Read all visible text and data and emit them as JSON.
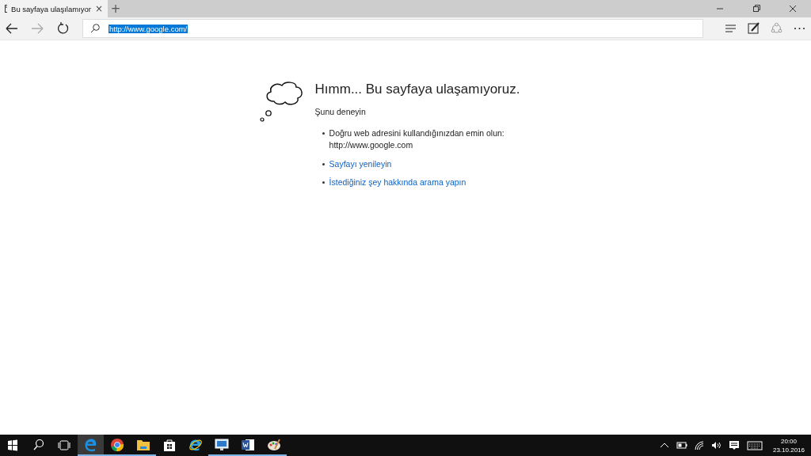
{
  "tabs": [
    {
      "title": "Bu sayfaya ulaşılamıyor",
      "close": "×",
      "selected": true
    }
  ],
  "new_tab": "+",
  "address_bar": {
    "value": "http://www.google.com/",
    "selected": true
  },
  "error_page": {
    "heading": "Hımm... Bu sayfaya ulaşamıyoruz.",
    "subheading": "Şunu deneyin",
    "items": [
      {
        "kind": "text",
        "lines": [
          "Doğru web adresini kullandığınızdan emin olun:",
          "http://www.google.com"
        ]
      },
      {
        "kind": "link",
        "lines": [
          "Sayfayı yenileyin"
        ]
      },
      {
        "kind": "link",
        "lines": [
          "İstediğiniz şey hakkında arama yapın"
        ]
      }
    ]
  },
  "taskbar": {
    "apps": [
      {
        "kind": "edge",
        "selected": true,
        "running": true
      },
      {
        "kind": "chrome",
        "selected": false,
        "running": true
      },
      {
        "kind": "explorer",
        "selected": false,
        "running": true
      },
      {
        "kind": "store",
        "selected": false,
        "running": false
      },
      {
        "kind": "ie",
        "selected": false,
        "running": false
      },
      {
        "kind": "remote",
        "selected": false,
        "running": true
      },
      {
        "kind": "word",
        "selected": false,
        "running": true
      },
      {
        "kind": "paint",
        "selected": false,
        "running": true
      }
    ],
    "time": "20:00",
    "date": "23.10.2016"
  }
}
